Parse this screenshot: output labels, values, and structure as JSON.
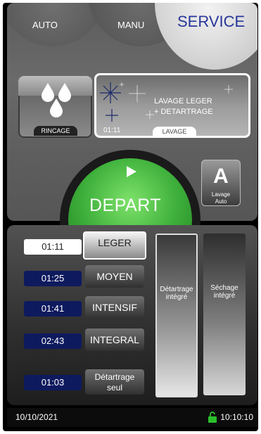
{
  "tabs": {
    "auto": "AUTO",
    "manu": "MANU",
    "service": "SERVICE"
  },
  "rincage": {
    "label": "RINCAGE"
  },
  "lavage": {
    "line1": "LAVAGE LEGER",
    "line2": "+ DETARTRAGE",
    "time": "01:11",
    "label": "LAVAGE"
  },
  "depart": {
    "label": "DEPART"
  },
  "lavage_auto": {
    "letter": "A",
    "line1": "Lavage",
    "line2": "Auto"
  },
  "programs": [
    {
      "time": "01:11",
      "name": "LEGER",
      "selected": true
    },
    {
      "time": "01:25",
      "name": "MOYEN"
    },
    {
      "time": "01:41",
      "name": "INTENSIF"
    },
    {
      "time": "02:43",
      "name": "INTEGRAL"
    },
    {
      "time": "01:03",
      "name_line1": "Détartrage",
      "name_line2": "seul"
    }
  ],
  "options": {
    "detartrage": {
      "line1": "Détartrage",
      "line2": "intégré"
    },
    "sechage": {
      "line1": "Séchage",
      "line2": "intégré"
    }
  },
  "status": {
    "date": "10/10/2021",
    "time": "10:10:10",
    "lock_color": "#2bc02b"
  },
  "colors": {
    "service": "#27369a",
    "time_box": "#0e1a5e",
    "depart": "#3fb13c"
  }
}
